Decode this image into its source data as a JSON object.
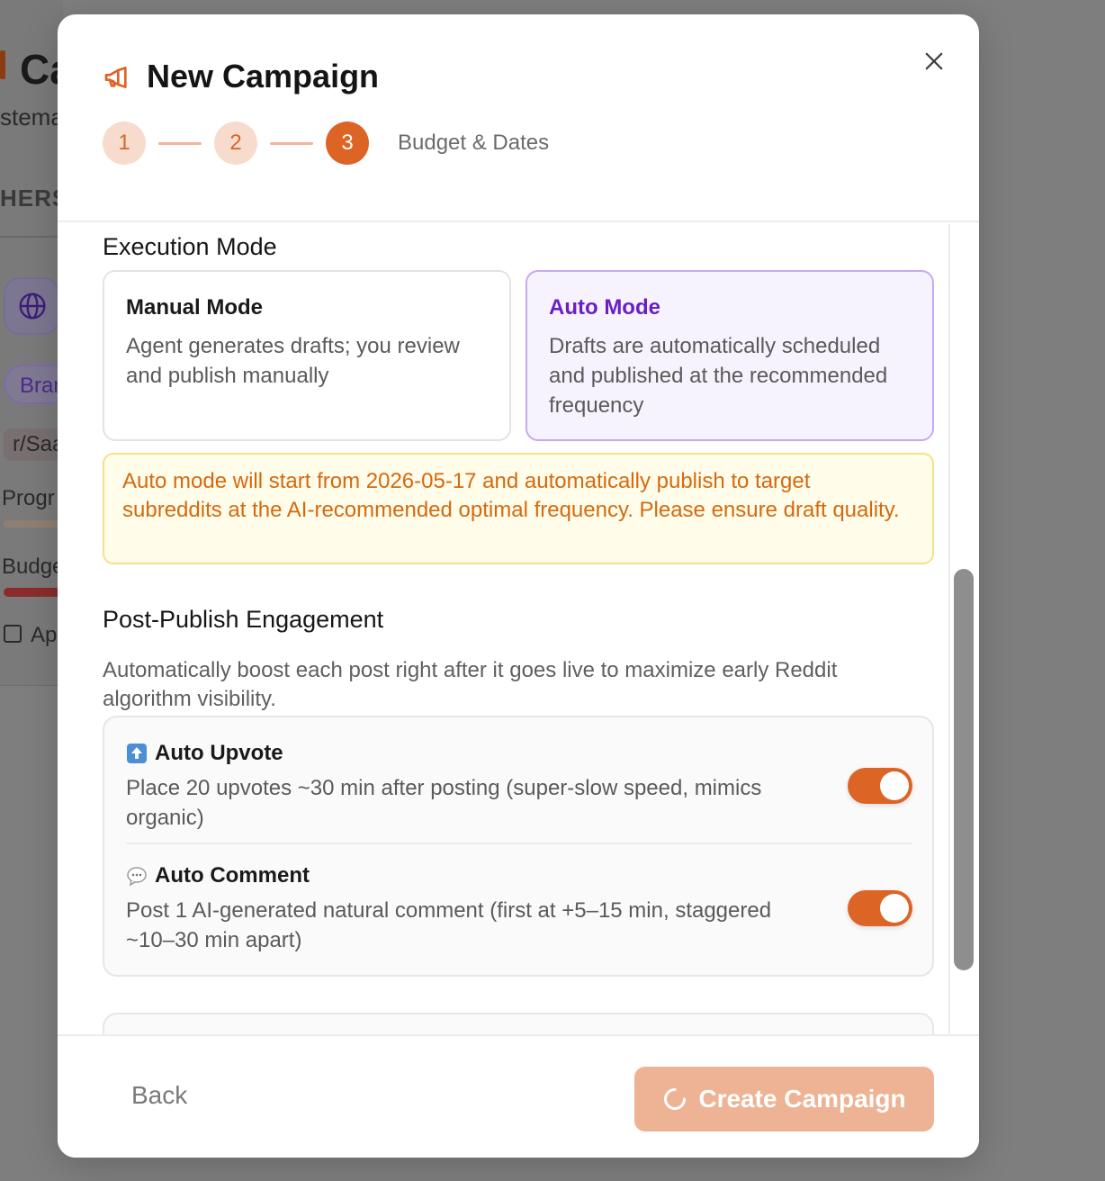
{
  "background": {
    "title": "Ca",
    "subtitle": "stema",
    "section": "HERS",
    "pill": "Brar",
    "tag": "r/Saa",
    "progress_label": "Progr",
    "budget_label": "Budge",
    "date_label": "Ap"
  },
  "modal": {
    "title": "New Campaign",
    "steps": [
      "1",
      "2",
      "3"
    ],
    "current_step_label": "Budget & Dates"
  },
  "execution": {
    "title": "Execution Mode",
    "manual": {
      "name": "Manual Mode",
      "desc": "Agent generates drafts; you review and publish manually"
    },
    "auto": {
      "name": "Auto Mode",
      "desc": "Drafts are automatically scheduled and published at the recommended frequency"
    },
    "selected": "auto",
    "warning": "Auto mode will start from 2026-05-17 and automatically publish to target subreddits at the AI-recommended optimal frequency. Please ensure draft quality."
  },
  "engagement": {
    "title": "Post-Publish Engagement",
    "desc": "Automatically boost each post right after it goes live to maximize early Reddit algorithm visibility.",
    "items": [
      {
        "icon": "up-arrow-icon",
        "title": "Auto Upvote",
        "desc": "Place 20 upvotes ~30 min after posting (super-slow speed, mimics organic)",
        "enabled": true
      },
      {
        "icon": "speech-bubble-icon",
        "title": "Auto Comment",
        "desc": "Post 1 AI-generated natural comment (first at +5–15 min, staggered ~10–30 min apart)",
        "enabled": true
      }
    ]
  },
  "footer": {
    "back_label": "Back",
    "create_label": "Create Campaign"
  },
  "colors": {
    "accent": "#dc6424",
    "accent_light": "#f7dccd",
    "auto_purple": "#6a1fc4",
    "warning_text": "#d46a10",
    "create_disabled": "#edb394"
  }
}
